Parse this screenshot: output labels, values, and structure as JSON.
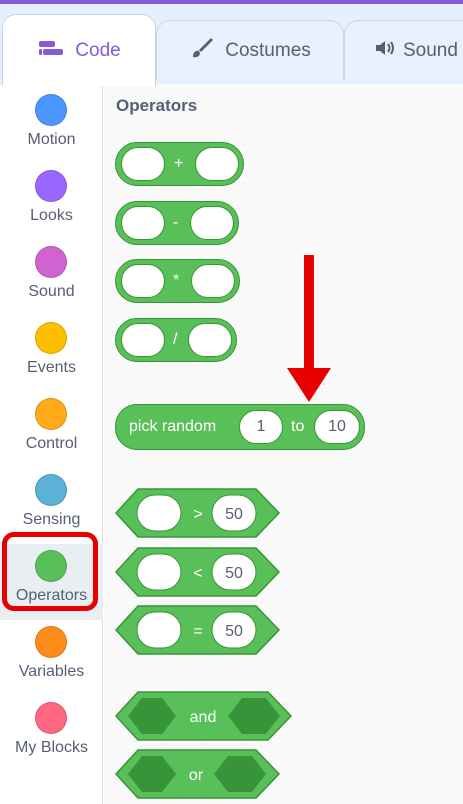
{
  "tabs": [
    {
      "label": "Code",
      "icon": "code-icon",
      "active": true
    },
    {
      "label": "Costumes",
      "icon": "brush-icon",
      "active": false
    },
    {
      "label": "Sound",
      "icon": "speaker-icon",
      "active": false
    }
  ],
  "categories": [
    {
      "label": "Motion",
      "color": "#4c97ff"
    },
    {
      "label": "Looks",
      "color": "#9966ff"
    },
    {
      "label": "Sound",
      "color": "#cf63cf"
    },
    {
      "label": "Events",
      "color": "#ffbf00"
    },
    {
      "label": "Control",
      "color": "#ffab19"
    },
    {
      "label": "Sensing",
      "color": "#5cb1d6"
    },
    {
      "label": "Operators",
      "color": "#59c059",
      "selected": true
    },
    {
      "label": "Variables",
      "color": "#ff8c1a"
    },
    {
      "label": "My Blocks",
      "color": "#ff6680"
    }
  ],
  "palette": {
    "section_title": "Operators",
    "operator_color": "#59c059",
    "arith_blocks": [
      {
        "op": "+"
      },
      {
        "op": "-"
      },
      {
        "op": "*"
      },
      {
        "op": "/"
      }
    ],
    "random_block": {
      "label": "pick random",
      "from": "1",
      "to_label": "to",
      "to": "10"
    },
    "compare_blocks": [
      {
        "op": ">",
        "value": "50"
      },
      {
        "op": "<",
        "value": "50"
      },
      {
        "op": "=",
        "value": "50"
      }
    ],
    "bool_blocks": [
      {
        "label": "and"
      },
      {
        "label": "or"
      }
    ]
  },
  "annotations": {
    "arrow_color": "#e60000",
    "highlight_color": "#e60000"
  }
}
